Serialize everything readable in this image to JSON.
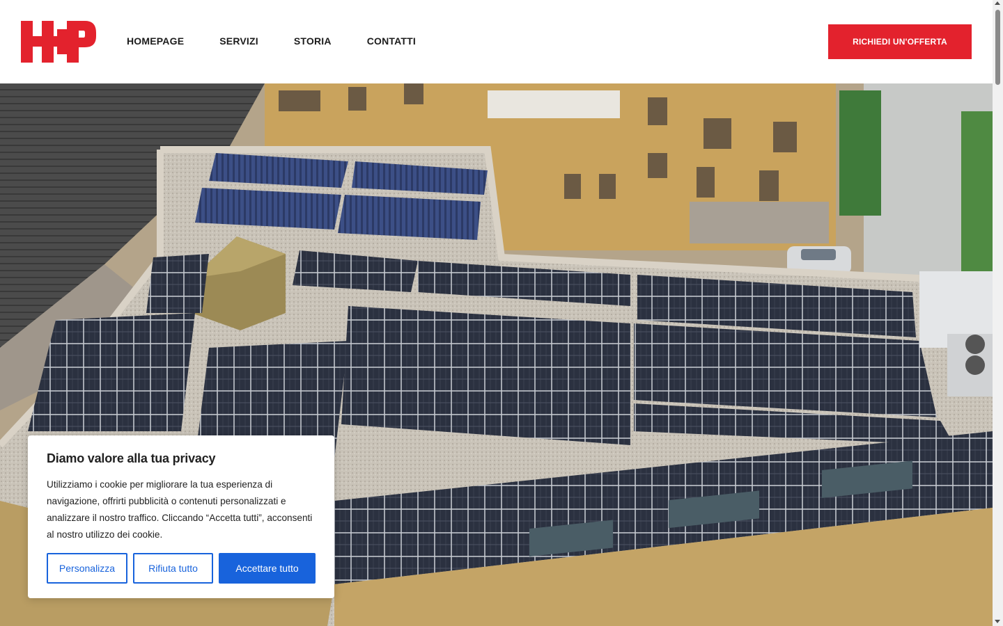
{
  "brand": {
    "logo_text": "H+P",
    "color": "#e3222d"
  },
  "nav": {
    "items": [
      {
        "label": "HOMEPAGE"
      },
      {
        "label": "SERVIZI"
      },
      {
        "label": "STORIA"
      },
      {
        "label": "CONTATTI"
      }
    ]
  },
  "header": {
    "cta_label": "RICHIEDI UN'OFFERTA"
  },
  "hero": {
    "image": "aerial-rooftop-solar-panels"
  },
  "cookie": {
    "title": "Diamo valore alla tua privacy",
    "text": "Utilizziamo i cookie per migliorare la tua esperienza di navigazione, offrirti pubblicità o contenuti personalizzati e analizzare il nostro traffico. Cliccando “Accetta tutti”, acconsenti al nostro utilizzo dei cookie.",
    "btn_customize": "Personalizza",
    "btn_reject": "Rifiuta tutto",
    "btn_accept": "Accettare tutto",
    "accent": "#1863dc"
  }
}
